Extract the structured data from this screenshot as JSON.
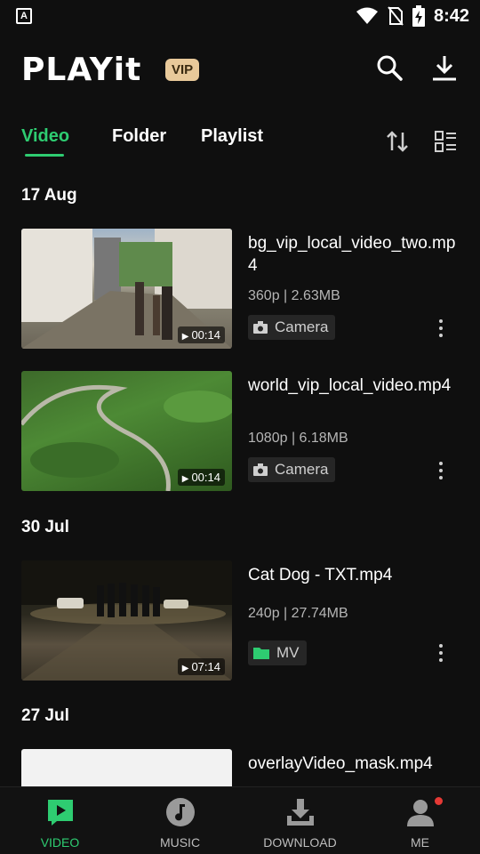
{
  "status_bar": {
    "app_icon_letter": "A",
    "time": "8:42"
  },
  "header": {
    "logo": "PLAYit",
    "vip_badge": "VIP"
  },
  "tabs": {
    "video": "Video",
    "folder": "Folder",
    "playlist": "Playlist",
    "active": "Video"
  },
  "sections": [
    {
      "date": "17 Aug",
      "items": [
        {
          "title": "bg_vip_local_video_two.mp4",
          "meta": "360p | 2.63MB",
          "tag": "Camera",
          "tag_icon": "camera-icon",
          "duration": "00:14"
        },
        {
          "title": "world_vip_local_video.mp4",
          "meta": "1080p | 6.18MB",
          "tag": "Camera",
          "tag_icon": "camera-icon",
          "duration": "00:14"
        }
      ]
    },
    {
      "date": "30 Jul",
      "items": [
        {
          "title": "Cat  Dog - TXT.mp4",
          "meta": "240p | 27.74MB",
          "tag": "MV",
          "tag_icon": "folder-icon",
          "duration": "07:14"
        }
      ]
    },
    {
      "date": "27 Jul",
      "items": [
        {
          "title": "overlayVideo_mask.mp4"
        }
      ]
    }
  ],
  "bottom_nav": {
    "video": "VIDEO",
    "music": "MUSIC",
    "download": "DOWNLOAD",
    "me": "ME"
  },
  "colors": {
    "accent": "#2ecc71",
    "background": "#0f0f0f",
    "vip_gold": "#e8c99a",
    "notification_dot": "#e53935"
  }
}
